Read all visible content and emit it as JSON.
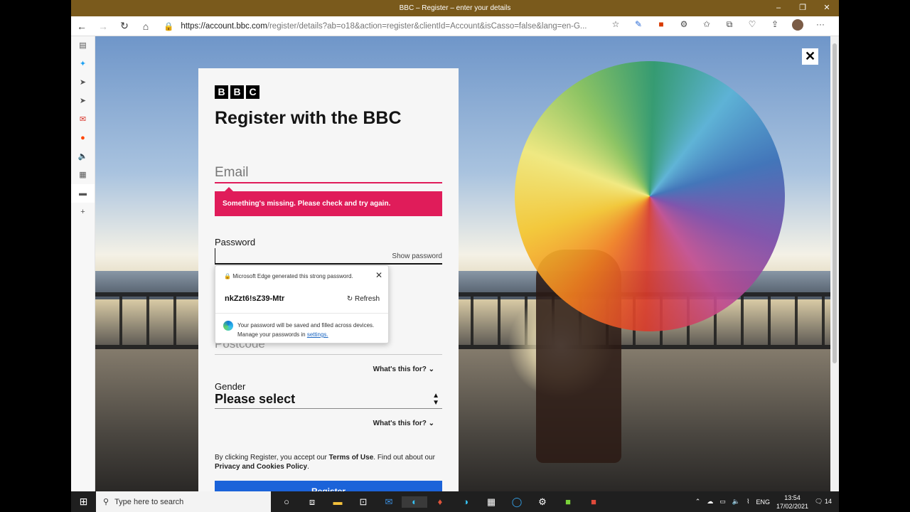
{
  "window": {
    "title": "BBC – Register – enter your details",
    "controls": [
      "–",
      "❐",
      "✕"
    ]
  },
  "browser": {
    "url_host": "https://account.bbc.com",
    "url_rest": "/register/details?ab=o18&action=register&clientId=Account&isCasso=false&lang=en-G..."
  },
  "page": {
    "logo": [
      "B",
      "B",
      "C"
    ],
    "heading": "Register with the BBC",
    "email_placeholder": "Email",
    "email_error": "Something's missing. Please check and try again.",
    "password_label": "Password",
    "show_password": "Show password",
    "postcode_placeholder": "Postcode",
    "whats_this": "What's this for?",
    "gender_label": "Gender",
    "gender_value": "Please select",
    "terms_prefix": "By clicking Register, you accept our ",
    "terms_link": "Terms of Use",
    "terms_middle": ". Find out about our ",
    "privacy_link": "Privacy and Cookies Policy",
    "terms_suffix": ".",
    "register_button": "Register",
    "close": "✕"
  },
  "password_popup": {
    "header": "Microsoft Edge generated this strong password.",
    "password": "nkZzt6!sZ39-Mtr",
    "refresh": "Refresh",
    "note_line1": "Your password will be saved and filled across devices.",
    "note_line2": "Manage your passwords in",
    "settings_link": "settings."
  },
  "taskbar": {
    "search_placeholder": "Type here to search",
    "language": "ENG",
    "time": "13:54",
    "date": "17/02/2021",
    "notification_count": "14"
  }
}
